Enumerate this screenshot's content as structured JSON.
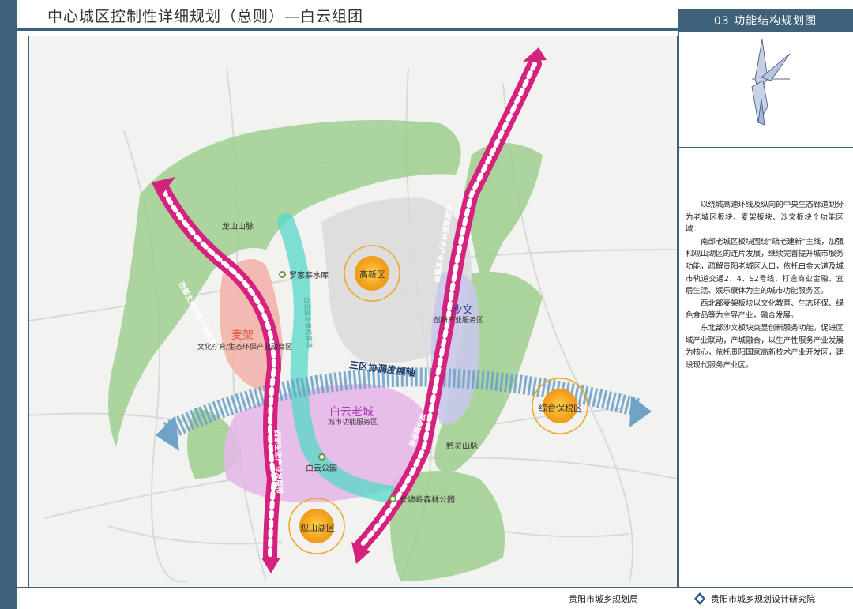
{
  "header": {
    "title": "中心城区控制性详细规划（总则）—白云组团",
    "tab_label": "03 功能结构规划图"
  },
  "map": {
    "zones": {
      "gaoxin": "高新区",
      "shawen": "沙文",
      "shawen_sub": "创新产业服务区",
      "maijia": "麦架",
      "maijia_sub": "文化教育/生态环保产业融合区",
      "baiyun": "白云老城",
      "baiyun_sub": "城市功能服务区",
      "zonghe": "综合保税区",
      "guanshanhu": "观山湖区"
    },
    "mountains": {
      "longshan": "龙山山脉",
      "qianling": "黔灵山脉"
    },
    "parks": {
      "luojiazhai": "罗家寨水库",
      "baiyun_park": "白云公园",
      "changpoling": "长坡岭森林公园"
    },
    "axis_label": "三区协调发展轴",
    "corridor_labels": {
      "east": "东部高新技术产业发展带",
      "east_lower": "城市服务带",
      "west_upper": "西部文化教育产业发展带",
      "west_lower": "西部生态产业发展带",
      "green": "白云生态景观廊道"
    }
  },
  "description": [
    "以绕城高速环线及纵向的中央生态廊道划分为老城区板块、麦架板块、沙文板块个功能区域：",
    "南部老城区板块围绕“疏老建新”主线，加强和观山湖区的连片发展，继续完善提升城市服务功能，疏解贵阳老城区人口，依托白金大道及城市轨道交通2、4、S2号线，打造商业金融、宜居生活、娱乐康体为主的城市功能服务区。",
    "西北部麦架板块以文化教育、生态环保、绿色食品等为主导产业，融合发展。",
    "东北部沙文板块突显创新服务功能，促进区域产业联动，产城融合，以生产性服务产业发展为核心，依托贵阳国家高新技术产业开发区，建设现代服务产业区。"
  ],
  "footer": {
    "left": "贵阳市城乡规划局",
    "right": "贵阳市城乡规划设计研究院"
  },
  "colors": {
    "frame": "#3f6179",
    "corridor": "#d6227f",
    "axis": "#6fa3c8",
    "green_corridor": "#4fd6c4",
    "circle": "#f0a420"
  }
}
